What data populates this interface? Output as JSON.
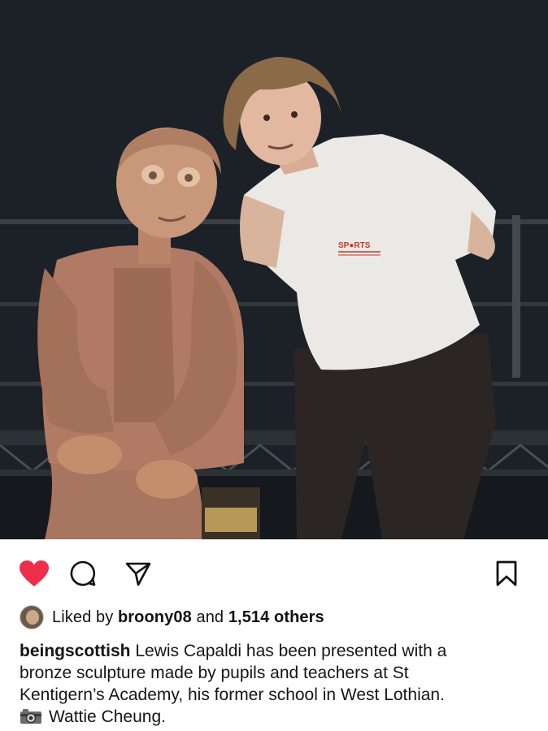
{
  "photo": {
    "shirt_logo": "SP●RTS"
  },
  "actions": {
    "like_icon": "heart-icon",
    "comment_icon": "speech-bubble-icon",
    "share_icon": "paper-plane-icon",
    "save_icon": "bookmark-icon",
    "like_color": "#ed2f4b"
  },
  "likes": {
    "prefix": "Liked by",
    "user": "broony08",
    "connector": "and",
    "count": "1,514 others"
  },
  "caption": {
    "username": "beingscottish",
    "text_line1": "Lewis Capaldi has been presented with a",
    "text_line2": "bronze sculpture made by pupils and teachers at St",
    "text_line3": "Kentigern’s Academy, his former school in West Lothian.",
    "credit": "Wattie Cheung."
  }
}
